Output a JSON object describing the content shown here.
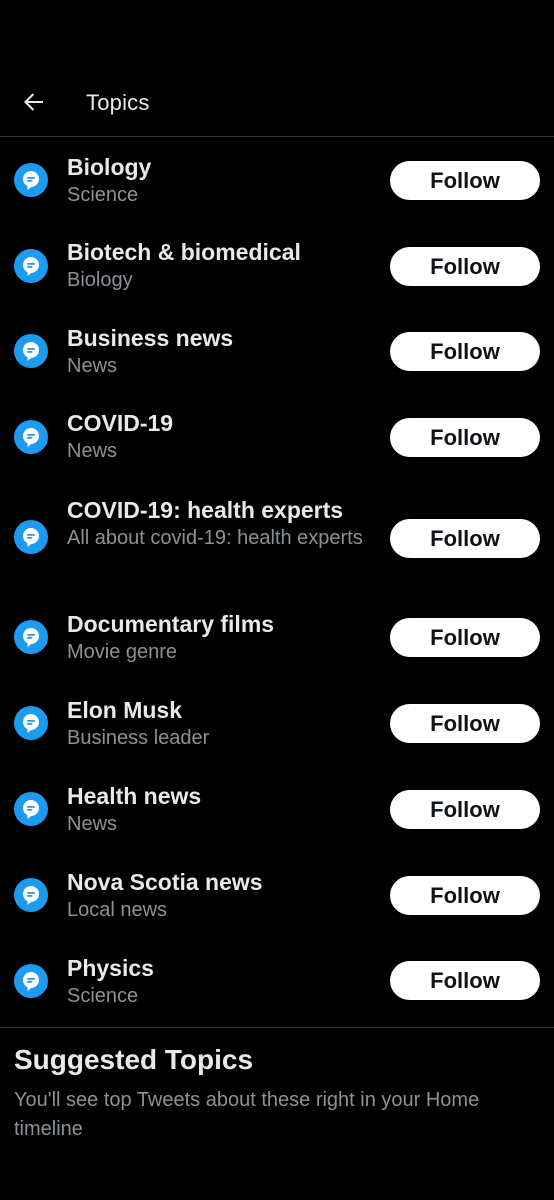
{
  "header": {
    "title": "Topics",
    "back_icon": "arrow-left-icon"
  },
  "topics": [
    {
      "name": "Biology",
      "subtitle": "Science",
      "button": "Follow"
    },
    {
      "name": "Biotech & biomedical",
      "subtitle": "Biology",
      "button": "Follow"
    },
    {
      "name": "Business news",
      "subtitle": "News",
      "button": "Follow"
    },
    {
      "name": "COVID-19",
      "subtitle": "News",
      "button": "Follow"
    },
    {
      "name": "COVID-19: health experts",
      "subtitle": "All about covid-19: health experts",
      "button": "Follow"
    },
    {
      "name": "Documentary films",
      "subtitle": "Movie genre",
      "button": "Follow"
    },
    {
      "name": "Elon Musk",
      "subtitle": "Business leader",
      "button": "Follow"
    },
    {
      "name": "Health news",
      "subtitle": "News",
      "button": "Follow"
    },
    {
      "name": "Nova Scotia news",
      "subtitle": "Local news",
      "button": "Follow"
    },
    {
      "name": "Physics",
      "subtitle": "Science",
      "button": "Follow"
    }
  ],
  "suggested": {
    "title": "Suggested Topics",
    "subtitle": "You'll see top Tweets about these right in your Home timeline"
  },
  "colors": {
    "background": "#000000",
    "accent": "#1d9bf0",
    "text_primary": "#e7e9ea",
    "text_secondary": "#8b9196",
    "button_bg": "#ffffff",
    "divider": "#2f3336"
  },
  "topic_icon": "topic-bubble-icon"
}
